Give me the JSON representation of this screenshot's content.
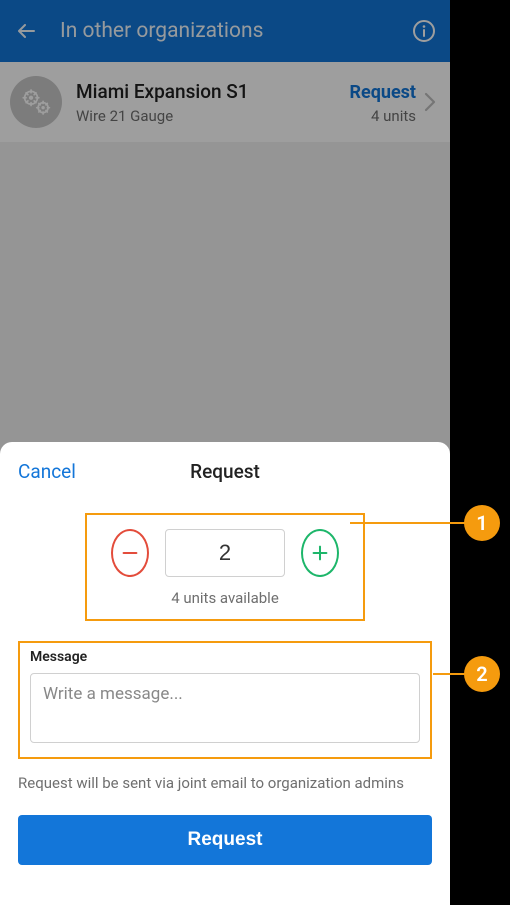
{
  "header": {
    "title": "In other organizations"
  },
  "item": {
    "name": "Miami Expansion S1",
    "subtitle": "Wire 21 Gauge",
    "action": "Request",
    "units": "4 units"
  },
  "sheet": {
    "cancel": "Cancel",
    "title": "Request",
    "quantity": "2",
    "available": "4 units available",
    "message_label": "Message",
    "message_placeholder": "Write a message...",
    "note": "Request will be sent via joint email to organization admins",
    "submit": "Request"
  },
  "callouts": [
    "1",
    "2"
  ]
}
